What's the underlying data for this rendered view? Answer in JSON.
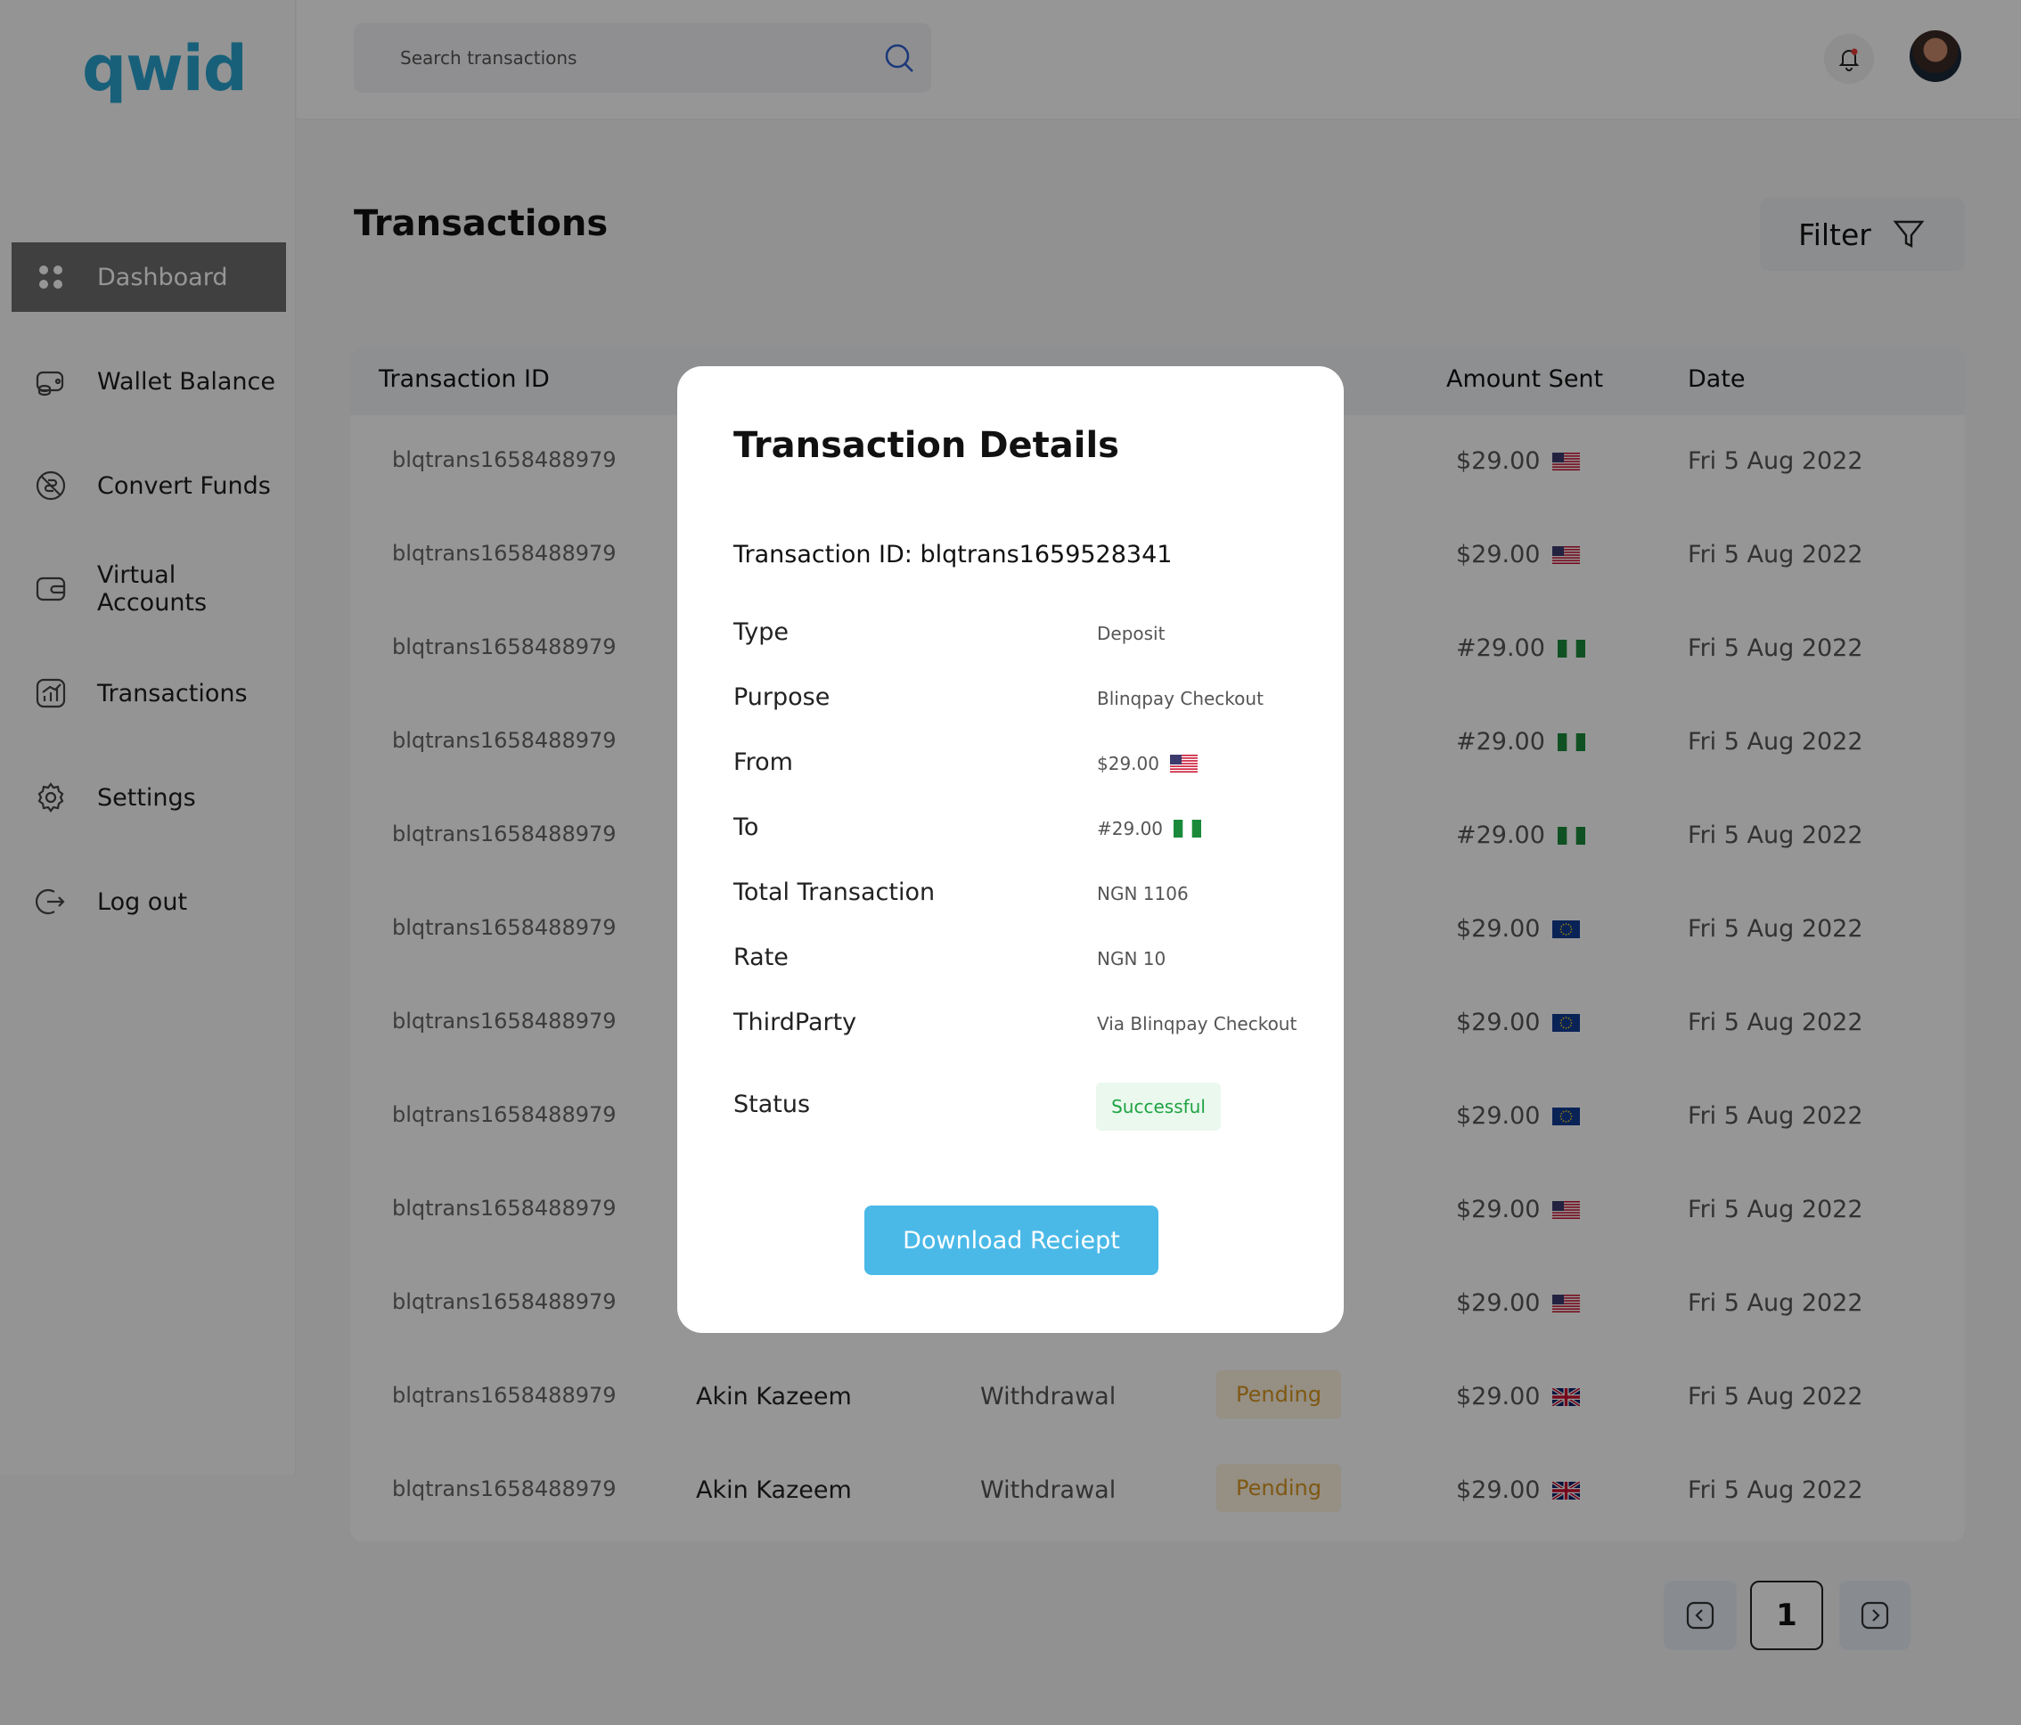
{
  "app": {
    "logo": "qwid"
  },
  "sidebar": {
    "items": [
      {
        "label": "Dashboard",
        "icon": "dashboard-icon",
        "active": true
      },
      {
        "label": "Wallet Balance",
        "icon": "wallet-icon"
      },
      {
        "label": "Convert Funds",
        "icon": "convert-icon"
      },
      {
        "label": "Virtual Accounts",
        "icon": "virtual-account-icon"
      },
      {
        "label": "Transactions",
        "icon": "chart-icon"
      },
      {
        "label": "Settings",
        "icon": "gear-icon"
      },
      {
        "label": "Log out",
        "icon": "logout-icon"
      }
    ]
  },
  "topbar": {
    "search_placeholder": "Search transactions"
  },
  "page": {
    "title": "Transactions",
    "filter_label": "Filter"
  },
  "table": {
    "headers": {
      "id": "Transaction ID",
      "amount": "Amount Sent",
      "date": "Date"
    },
    "rows": [
      {
        "id": "blqtrans1658488979",
        "name": "",
        "type": "",
        "status": "",
        "amount": "$29.00",
        "flag": "us",
        "date": "Fri 5 Aug 2022"
      },
      {
        "id": "blqtrans1658488979",
        "name": "",
        "type": "",
        "status": "",
        "amount": "$29.00",
        "flag": "us",
        "date": "Fri 5 Aug 2022"
      },
      {
        "id": "blqtrans1658488979",
        "name": "",
        "type": "",
        "status": "",
        "amount": "#29.00",
        "flag": "ng",
        "date": "Fri 5 Aug 2022"
      },
      {
        "id": "blqtrans1658488979",
        "name": "",
        "type": "",
        "status": "",
        "amount": "#29.00",
        "flag": "ng",
        "date": "Fri 5 Aug 2022"
      },
      {
        "id": "blqtrans1658488979",
        "name": "",
        "type": "",
        "status": "",
        "amount": "#29.00",
        "flag": "ng",
        "date": "Fri 5 Aug 2022"
      },
      {
        "id": "blqtrans1658488979",
        "name": "",
        "type": "",
        "status": "",
        "amount": "$29.00",
        "flag": "eu",
        "date": "Fri 5 Aug 2022"
      },
      {
        "id": "blqtrans1658488979",
        "name": "",
        "type": "",
        "status": "",
        "amount": "$29.00",
        "flag": "eu",
        "date": "Fri 5 Aug 2022"
      },
      {
        "id": "blqtrans1658488979",
        "name": "",
        "type": "",
        "status": "",
        "amount": "$29.00",
        "flag": "eu",
        "date": "Fri 5 Aug 2022"
      },
      {
        "id": "blqtrans1658488979",
        "name": "",
        "type": "",
        "status": "",
        "amount": "$29.00",
        "flag": "us",
        "date": "Fri 5 Aug 2022"
      },
      {
        "id": "blqtrans1658488979",
        "name": "",
        "type": "",
        "status": "",
        "amount": "$29.00",
        "flag": "us",
        "date": "Fri 5 Aug 2022"
      },
      {
        "id": "blqtrans1658488979",
        "name": "Akin Kazeem",
        "type": "Withdrawal",
        "status": "Pending",
        "amount": "$29.00",
        "flag": "gb",
        "date": "Fri 5 Aug 2022"
      },
      {
        "id": "blqtrans1658488979",
        "name": "Akin Kazeem",
        "type": "Withdrawal",
        "status": "Pending",
        "amount": "$29.00",
        "flag": "gb",
        "date": "Fri 5 Aug 2022"
      }
    ]
  },
  "pagination": {
    "current_page": "1"
  },
  "modal": {
    "title": "Transaction Details",
    "transaction_id_line": "Transaction ID: blqtrans1659528341",
    "details": [
      {
        "label": "Type",
        "value": "Deposit"
      },
      {
        "label": "Purpose",
        "value": "Blinqpay Checkout"
      },
      {
        "label": "From",
        "value": "$29.00",
        "flag": "us"
      },
      {
        "label": "To",
        "value": "#29.00",
        "flag": "ng"
      },
      {
        "label": "Total Transaction",
        "value": "NGN 1106"
      },
      {
        "label": "Rate",
        "value": "NGN 10"
      },
      {
        "label": "ThirdParty",
        "value": "Via Blinqpay Checkout"
      }
    ],
    "status_label": "Status",
    "status_value": "Successful",
    "download_label": "Download Reciept"
  },
  "colors": {
    "brand": "#2aa3cf",
    "button": "#4ab9e8",
    "success_text": "#1fa343",
    "success_bg": "#eaf8ee",
    "pending_text": "#d9961f",
    "pending_bg": "#fdf3e0",
    "overlay": "rgba(0,0,0,0.41)"
  }
}
